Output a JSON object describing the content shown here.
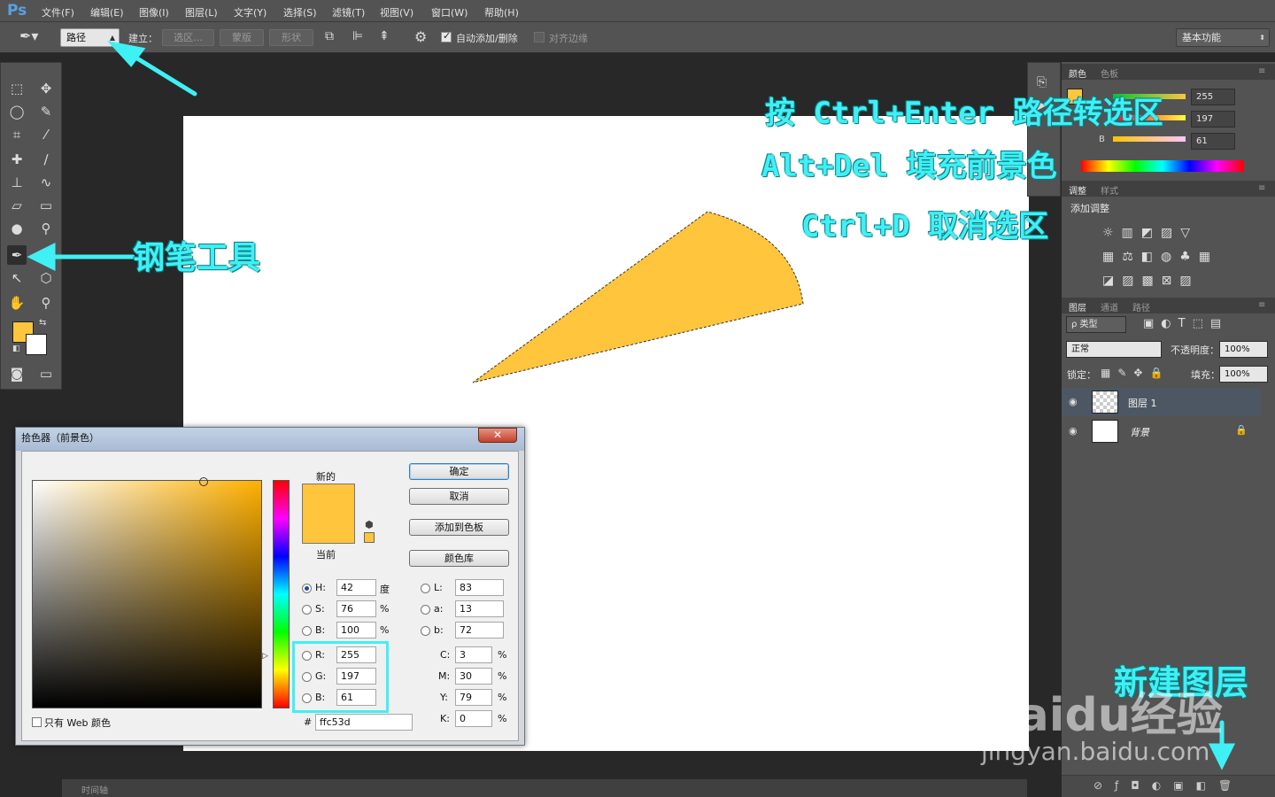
{
  "app": {
    "logo": "Ps"
  },
  "menu": [
    "文件(F)",
    "编辑(E)",
    "图像(I)",
    "图层(L)",
    "文字(Y)",
    "选择(S)",
    "滤镜(T)",
    "视图(V)",
    "窗口(W)",
    "帮助(H)"
  ],
  "options": {
    "mode_select": "路径",
    "make_label": "建立：",
    "selection_btn": "选区...",
    "mask_btn": "蒙版",
    "shape_btn": "形状",
    "auto_add_delete": "自动添加/删除",
    "auto_add_checked": true,
    "align_edges": "对齐边缘",
    "align_checked": false,
    "workspace": "基本功能"
  },
  "colors": {
    "foreground": "#ffc53d",
    "background": "#ffffff",
    "annotation": "#3ff0f5",
    "ui_dark": "#535353"
  },
  "color_panel": {
    "tabs": [
      "颜色",
      "色板"
    ],
    "r": "255",
    "g": "197",
    "b_label": "B",
    "b": "61"
  },
  "adjust_panel": {
    "tabs": [
      "调整",
      "样式"
    ],
    "title": "添加调整"
  },
  "layers_panel": {
    "tabs": [
      "图层",
      "通道",
      "路径"
    ],
    "filter": "ρ 类型",
    "blend_mode": "正常",
    "opacity_label": "不透明度：",
    "opacity": "100%",
    "lock_label": "锁定：",
    "fill_label": "填充：",
    "fill": "100%",
    "layers": [
      {
        "name": "图层 1",
        "selected": true
      },
      {
        "name": "背景",
        "selected": false,
        "locked": true
      }
    ]
  },
  "picker": {
    "title": "拾色器（前景色）",
    "new_label": "新的",
    "current_label": "当前",
    "ok": "确定",
    "cancel": "取消",
    "add_swatch": "添加到色板",
    "color_lib": "颜色库",
    "h_label": "H:",
    "h": "42",
    "h_unit": "度",
    "s_label": "S:",
    "s": "76",
    "s_unit": "%",
    "bb_label": "B:",
    "bb": "100",
    "bb_unit": "%",
    "r_label": "R:",
    "r": "255",
    "g_label": "G:",
    "g": "197",
    "b_label": "B:",
    "b": "61",
    "l_label": "L:",
    "l": "83",
    "a_label": "a:",
    "a": "13",
    "lab_b_label": "b:",
    "lab_b": "72",
    "c_label": "C:",
    "c": "3",
    "m_label": "M:",
    "m": "30",
    "y_label": "Y:",
    "y": "79",
    "k_label": "K:",
    "k": "0",
    "pct": "%",
    "hex_label": "#",
    "hex": "ffc53d",
    "web_only": "只有 Web 颜色"
  },
  "annotations": {
    "pen_tool": "钢笔工具",
    "step1": "按 Ctrl+Enter 路径转选区",
    "step2": "Alt+Del 填充前景色",
    "step3": "Ctrl+D 取消选区",
    "new_layer": "新建图层"
  },
  "bottom": {
    "timeline": "时间轴"
  },
  "watermark": {
    "brand": "Baidu经验",
    "url": "jingyan.baidu.com"
  }
}
